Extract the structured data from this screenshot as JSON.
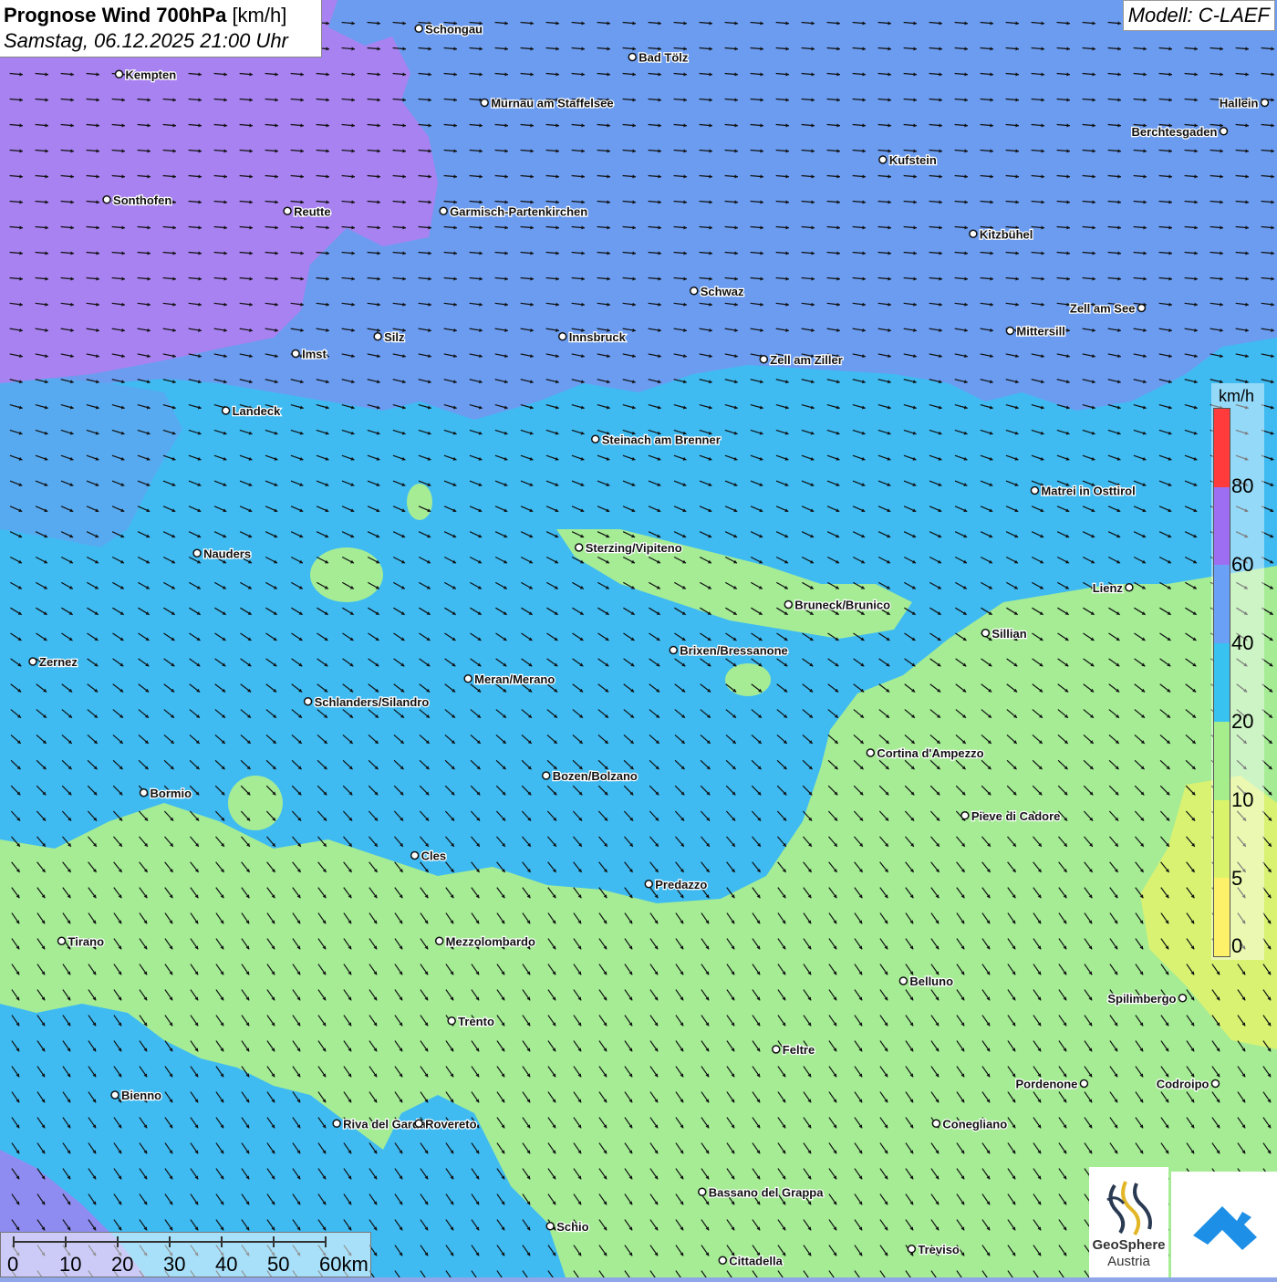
{
  "title": {
    "bold": "Prognose Wind 700hPa",
    "unit": "[km/h]",
    "datetime": "Samstag, 06.12.2025 21:00 Uhr"
  },
  "model_label": "Modell: C-LAEF",
  "legend": {
    "unit": "km/h",
    "ticks": [
      "0",
      "5",
      "10",
      "20",
      "40",
      "60",
      "80"
    ],
    "colors": [
      "#fdf16a",
      "#d9f46a",
      "#a6ee8c",
      "#37c2f0",
      "#6aa0f5",
      "#9e6ef2",
      "#ff3b3b"
    ]
  },
  "scale_bar": {
    "labels": [
      "0",
      "10",
      "20",
      "30",
      "40",
      "50",
      "60km"
    ]
  },
  "colors": {
    "purple": "#a882f0",
    "blue": "#6b9cf0",
    "cyan": "#3fbbf2",
    "green": "#a5ec95",
    "yellow": "#d9f272"
  },
  "logos": {
    "geosphere_line1": "GeoSphere",
    "geosphere_line2": "Austria"
  },
  "cities": [
    {
      "name": "Schongau",
      "lon": 11.04,
      "lat": 47.81
    },
    {
      "name": "Bad Tölz",
      "lon": 11.56,
      "lat": 47.76
    },
    {
      "name": "Kempten",
      "lon": 10.31,
      "lat": 47.73
    },
    {
      "name": "Murnau am Staffelsee",
      "lon": 11.2,
      "lat": 47.68
    },
    {
      "name": "Hallein",
      "lon": 13.1,
      "lat": 47.68
    },
    {
      "name": "Berchtesgaden",
      "lon": 13.0,
      "lat": 47.63
    },
    {
      "name": "Kufstein",
      "lon": 12.17,
      "lat": 47.58
    },
    {
      "name": "Sonthofen",
      "lon": 10.28,
      "lat": 47.51
    },
    {
      "name": "Reutte",
      "lon": 10.72,
      "lat": 47.49
    },
    {
      "name": "Garmisch-Partenkirchen",
      "lon": 11.1,
      "lat": 47.49
    },
    {
      "name": "Kitzbühel",
      "lon": 12.39,
      "lat": 47.45
    },
    {
      "name": "Schwaz",
      "lon": 11.71,
      "lat": 47.35
    },
    {
      "name": "Zell am See",
      "lon": 12.8,
      "lat": 47.32
    },
    {
      "name": "Mittersill",
      "lon": 12.48,
      "lat": 47.28
    },
    {
      "name": "Innsbruck",
      "lon": 11.39,
      "lat": 47.27
    },
    {
      "name": "Silz",
      "lon": 10.94,
      "lat": 47.27
    },
    {
      "name": "Imst",
      "lon": 10.74,
      "lat": 47.24
    },
    {
      "name": "Zell am Ziller",
      "lon": 11.88,
      "lat": 47.23
    },
    {
      "name": "Landeck",
      "lon": 10.57,
      "lat": 47.14
    },
    {
      "name": "Steinach am Brenner",
      "lon": 11.47,
      "lat": 47.09
    },
    {
      "name": "Matrei in Osttirol",
      "lon": 12.54,
      "lat": 47.0
    },
    {
      "name": "Nauders",
      "lon": 10.5,
      "lat": 46.89
    },
    {
      "name": "Sterzing/Vipiteno",
      "lon": 11.43,
      "lat": 46.9
    },
    {
      "name": "Lienz",
      "lon": 12.77,
      "lat": 46.83
    },
    {
      "name": "Bruneck/Brunico",
      "lon": 11.94,
      "lat": 46.8
    },
    {
      "name": "Sillian",
      "lon": 12.42,
      "lat": 46.75
    },
    {
      "name": "Brixen/Bressanone",
      "lon": 11.66,
      "lat": 46.72
    },
    {
      "name": "Zernez",
      "lon": 10.1,
      "lat": 46.7
    },
    {
      "name": "Meran/Merano",
      "lon": 11.16,
      "lat": 46.67
    },
    {
      "name": "Schlanders/Silandro",
      "lon": 10.77,
      "lat": 46.63
    },
    {
      "name": "Cortina d'Ampezzo",
      "lon": 12.14,
      "lat": 46.54
    },
    {
      "name": "Bozen/Bolzano",
      "lon": 11.35,
      "lat": 46.5
    },
    {
      "name": "Bormio",
      "lon": 10.37,
      "lat": 46.47
    },
    {
      "name": "Pieve di Cadore",
      "lon": 12.37,
      "lat": 46.43
    },
    {
      "name": "Cles",
      "lon": 11.03,
      "lat": 46.36
    },
    {
      "name": "Predazzo",
      "lon": 11.6,
      "lat": 46.31
    },
    {
      "name": "Tirano",
      "lon": 10.17,
      "lat": 46.21
    },
    {
      "name": "Mezzolombardo",
      "lon": 11.09,
      "lat": 46.21
    },
    {
      "name": "Belluno",
      "lon": 12.22,
      "lat": 46.14
    },
    {
      "name": "Spilimbergo",
      "lon": 12.9,
      "lat": 46.11
    },
    {
      "name": "Trento",
      "lon": 11.12,
      "lat": 46.07
    },
    {
      "name": "Feltre",
      "lon": 11.91,
      "lat": 46.02
    },
    {
      "name": "Pordenone",
      "lon": 12.66,
      "lat": 45.96
    },
    {
      "name": "Codroipo",
      "lon": 12.98,
      "lat": 45.96
    },
    {
      "name": "Bienno",
      "lon": 10.3,
      "lat": 45.94
    },
    {
      "name": "Riva del Garda",
      "lon": 10.84,
      "lat": 45.89
    },
    {
      "name": "Rovereto",
      "lon": 11.04,
      "lat": 45.89
    },
    {
      "name": "Conegliano",
      "lon": 12.3,
      "lat": 45.89
    },
    {
      "name": "Bassano del Grappa",
      "lon": 11.73,
      "lat": 45.77
    },
    {
      "name": "Schio",
      "lon": 11.36,
      "lat": 45.71
    },
    {
      "name": "Treviso",
      "lon": 12.24,
      "lat": 45.67
    },
    {
      "name": "Cittadella",
      "lon": 11.78,
      "lat": 45.65
    }
  ]
}
